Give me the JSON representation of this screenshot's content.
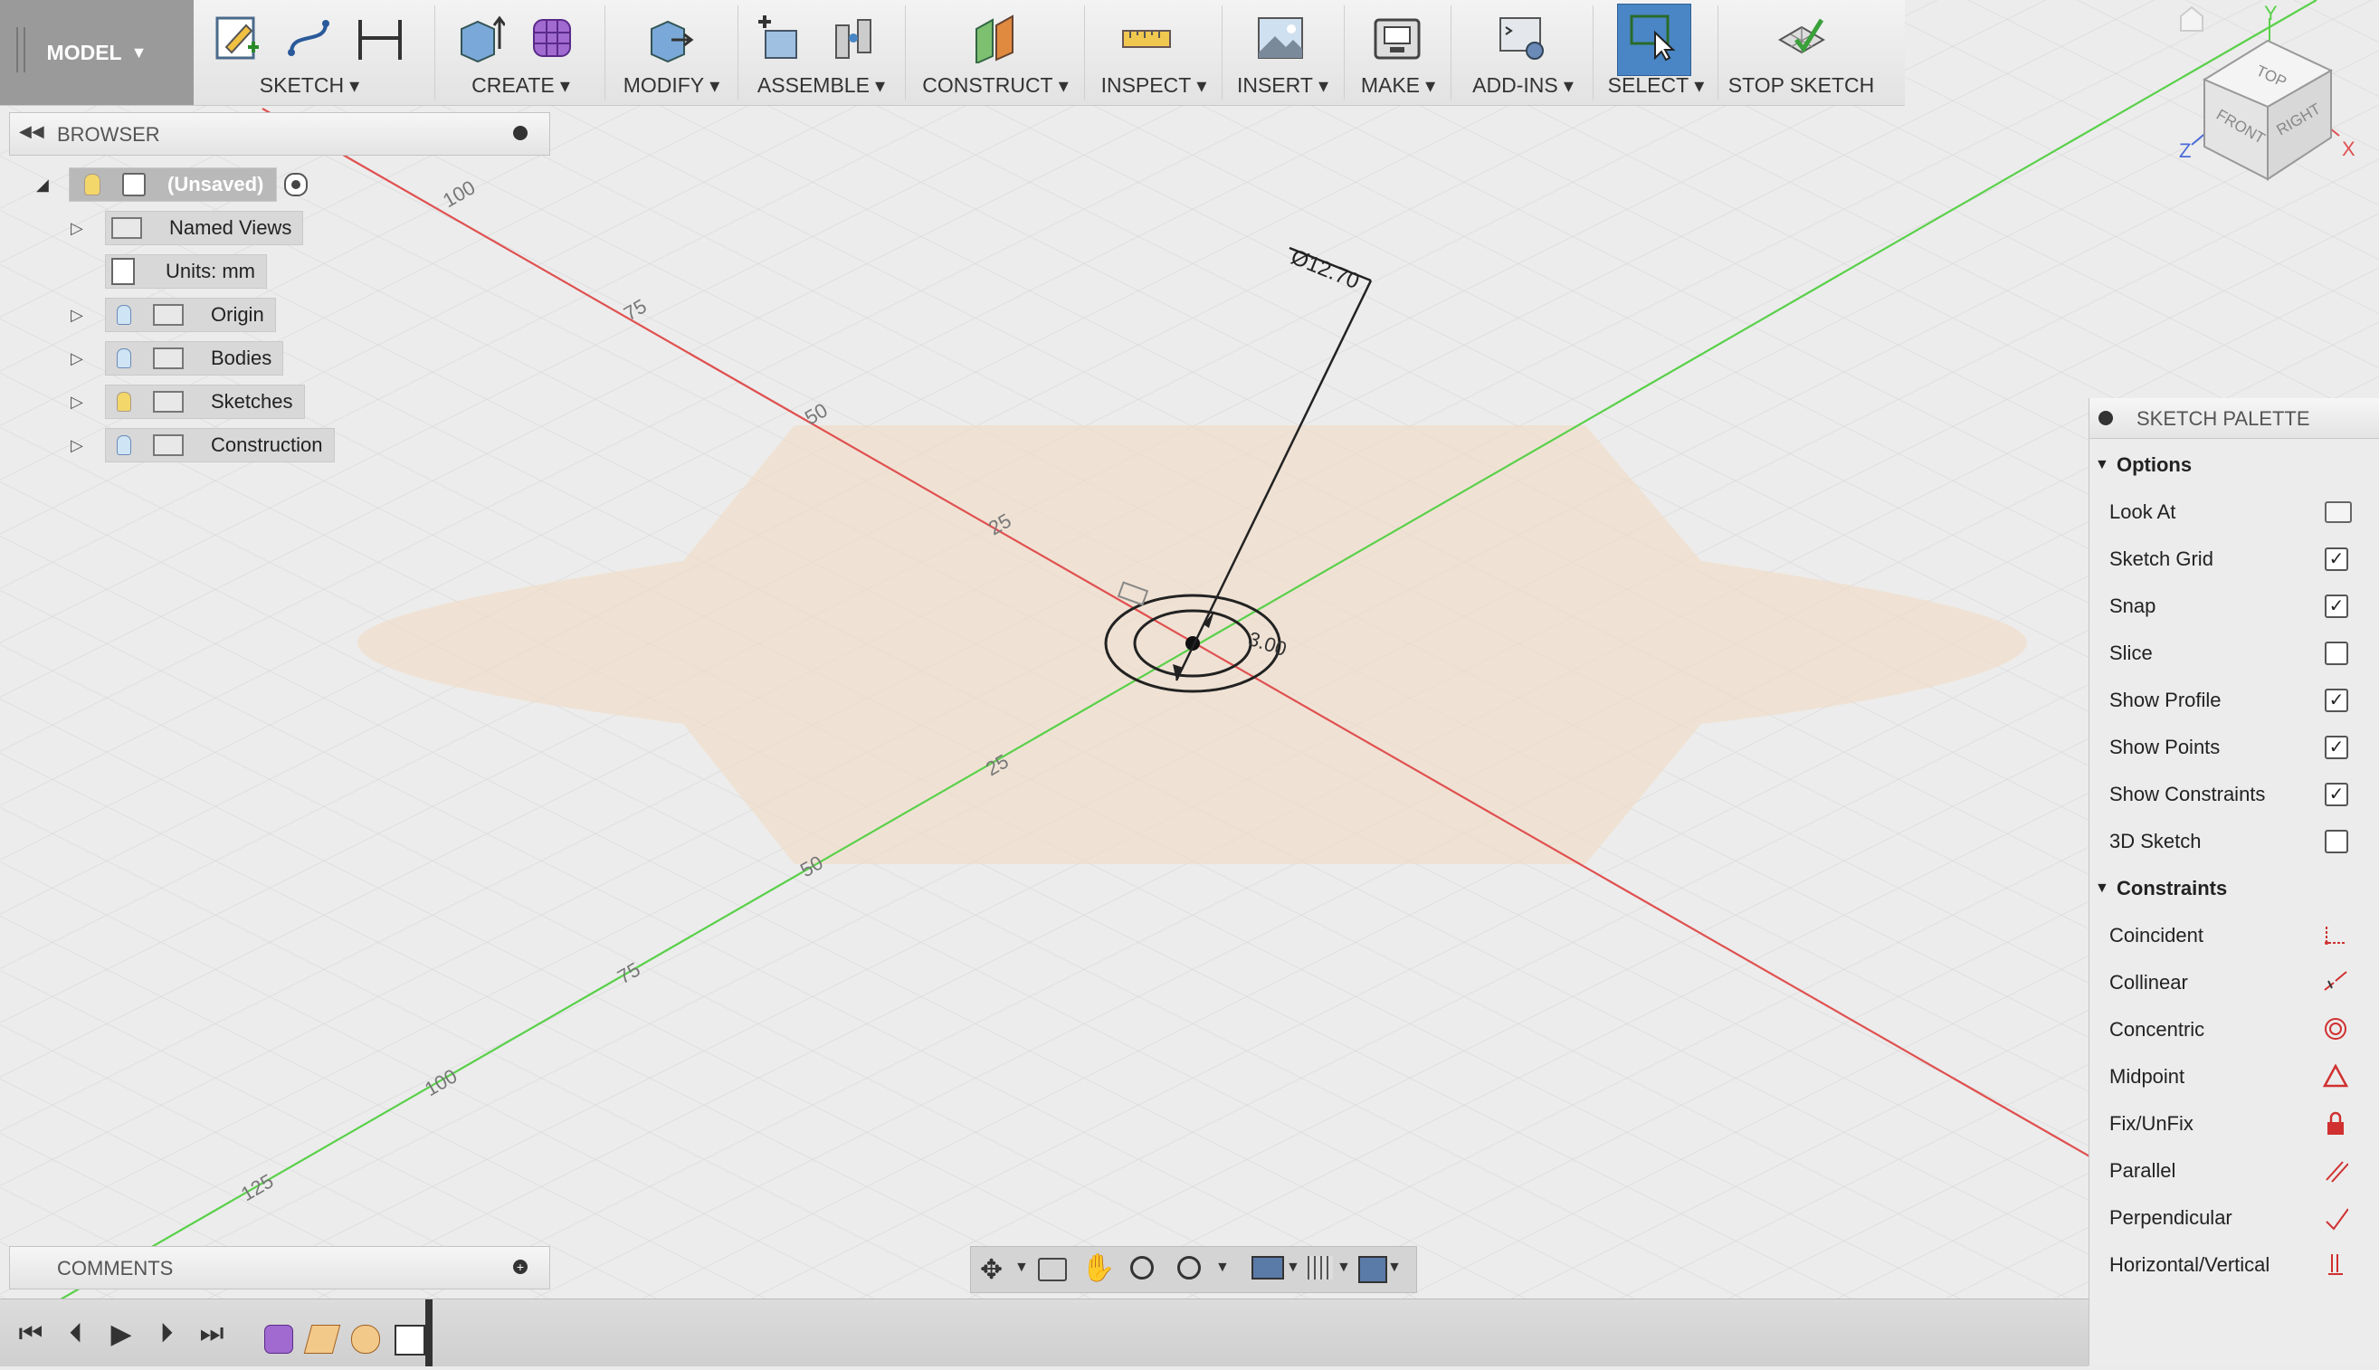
{
  "toolbar": {
    "workspace": "MODEL",
    "groups": [
      {
        "label": "SKETCH"
      },
      {
        "label": "CREATE"
      },
      {
        "label": "MODIFY"
      },
      {
        "label": "ASSEMBLE"
      },
      {
        "label": "CONSTRUCT"
      },
      {
        "label": "INSPECT"
      },
      {
        "label": "INSERT"
      },
      {
        "label": "MAKE"
      },
      {
        "label": "ADD-INS"
      },
      {
        "label": "SELECT"
      },
      {
        "label": "STOP SKETCH"
      }
    ]
  },
  "browser": {
    "title": "BROWSER",
    "root": "(Unsaved)",
    "items": [
      {
        "label": "Named Views"
      },
      {
        "label": "Units: mm"
      },
      {
        "label": "Origin"
      },
      {
        "label": "Bodies"
      },
      {
        "label": "Sketches"
      },
      {
        "label": "Construction"
      }
    ]
  },
  "comments": {
    "title": "COMMENTS"
  },
  "viewcube": {
    "top": "TOP",
    "front": "FRONT",
    "right": "RIGHT",
    "x": "X",
    "y": "Y",
    "z": "Z"
  },
  "canvas": {
    "red_ticks": [
      "100",
      "75",
      "50",
      "25"
    ],
    "green_ticks": [
      "25",
      "50",
      "75",
      "100",
      "125"
    ],
    "dimension_diameter": "Ø12.70",
    "dimension_small": "3.00"
  },
  "palette": {
    "title": "SKETCH PALETTE",
    "options_header": "Options",
    "options": [
      {
        "label": "Look At",
        "checked": null
      },
      {
        "label": "Sketch Grid",
        "checked": true
      },
      {
        "label": "Snap",
        "checked": true
      },
      {
        "label": "Slice",
        "checked": false
      },
      {
        "label": "Show Profile",
        "checked": true
      },
      {
        "label": "Show Points",
        "checked": true
      },
      {
        "label": "Show Constraints",
        "checked": true
      },
      {
        "label": "3D Sketch",
        "checked": false
      }
    ],
    "constraints_header": "Constraints",
    "constraints": [
      {
        "label": "Coincident",
        "icon": "coincident-icon"
      },
      {
        "label": "Collinear",
        "icon": "collinear-icon"
      },
      {
        "label": "Concentric",
        "icon": "concentric-icon"
      },
      {
        "label": "Midpoint",
        "icon": "midpoint-icon"
      },
      {
        "label": "Fix/UnFix",
        "icon": "lock-icon"
      },
      {
        "label": "Parallel",
        "icon": "parallel-icon"
      },
      {
        "label": "Perpendicular",
        "icon": "perpendicular-icon"
      },
      {
        "label": "Horizontal/Vertical",
        "icon": "horizontal-vertical-icon"
      }
    ]
  },
  "colors": {
    "accent": "#4a86c5",
    "x_axis": "#e05050",
    "y_axis": "#5ad04a",
    "constraint_red": "#d03030"
  }
}
